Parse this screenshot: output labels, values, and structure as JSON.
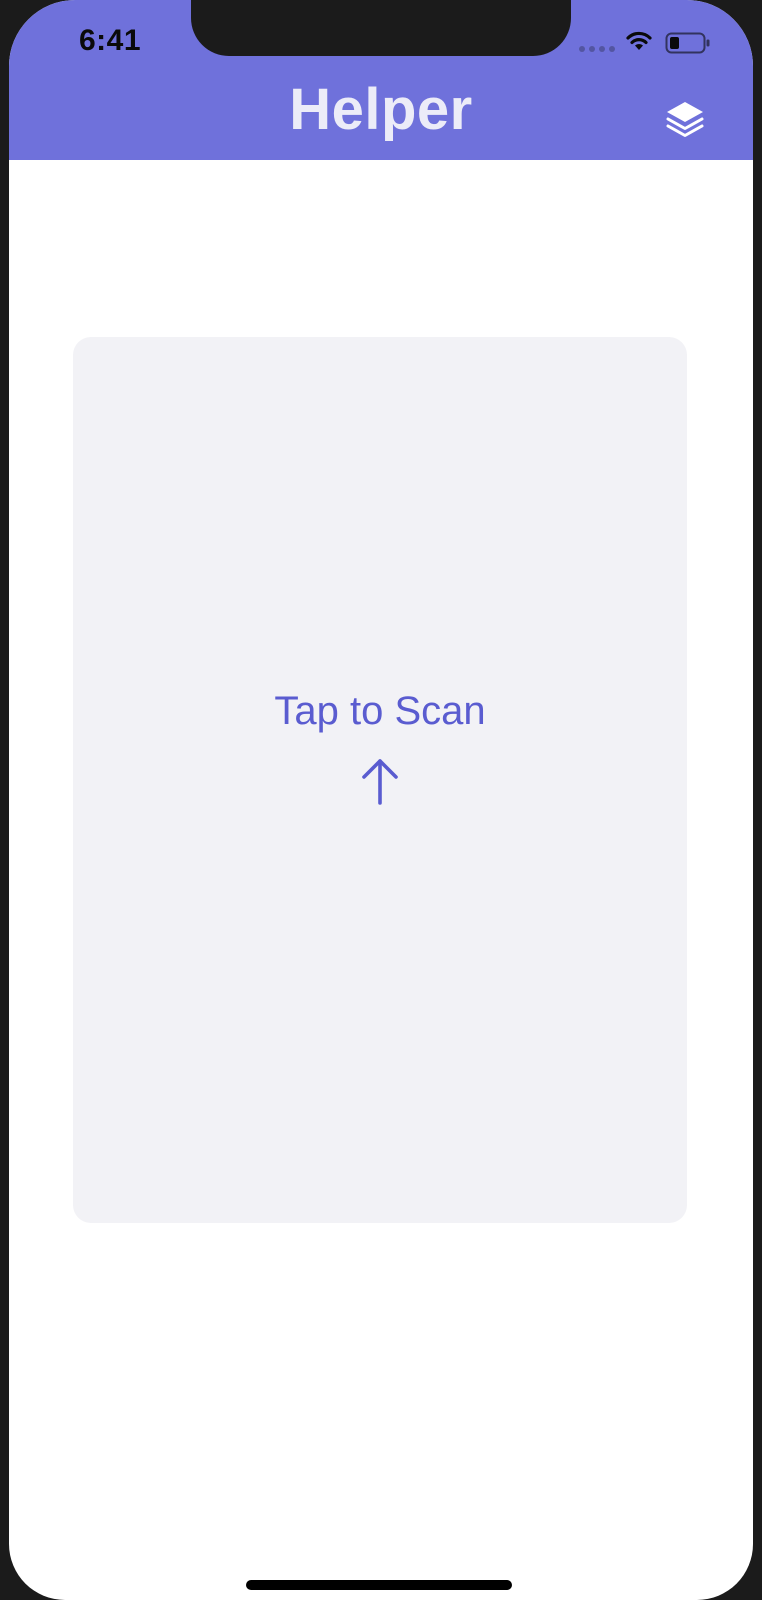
{
  "status_bar": {
    "time": "6:41"
  },
  "header": {
    "title": "Helper",
    "icon": "layers-icon"
  },
  "scan_area": {
    "label": "Tap to Scan",
    "icon": "arrow-up-icon"
  },
  "colors": {
    "accent": "#6f71db",
    "scan_text": "#5a5cd0",
    "card_background": "#f2f2f6"
  }
}
